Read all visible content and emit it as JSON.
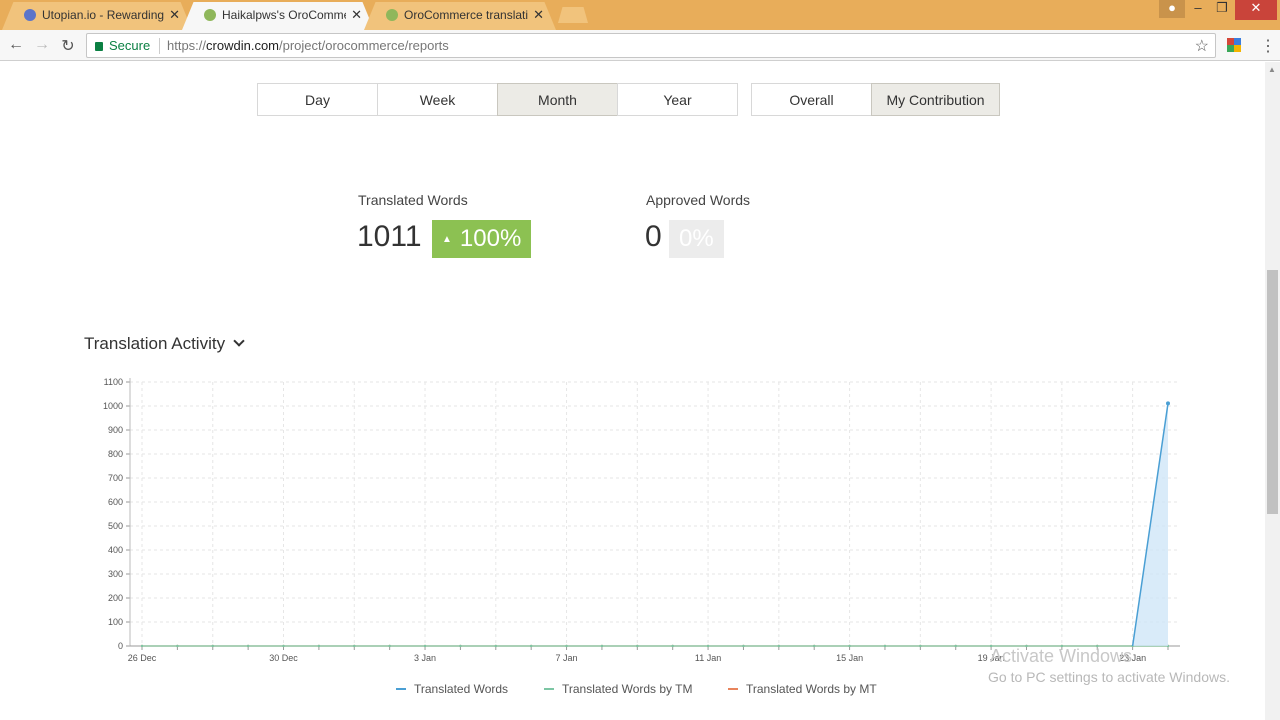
{
  "browser": {
    "tabs": [
      {
        "title": "Utopian.io - Rewarding C",
        "favicon_color": "#5b74c9"
      },
      {
        "title": "Haikalpws's OroCommer",
        "favicon_color": "#8fb75b"
      },
      {
        "title": "OroCommerce translatio",
        "favicon_color": "#8fb75b"
      }
    ],
    "close_glyph": "✕",
    "secure_label": "Secure",
    "url_scheme": "https://",
    "url_host": "crowdin.com",
    "url_path": "/project/orocommerce/reports"
  },
  "periods": [
    "Day",
    "Week",
    "Month",
    "Year"
  ],
  "active_period": "Month",
  "scopes": [
    "Overall",
    "My Contribution"
  ],
  "active_scope": "My Contribution",
  "stats": {
    "translated_label": "Translated Words",
    "translated_value": "1011",
    "translated_change": "100%",
    "approved_label": "Approved Words",
    "approved_value": "0",
    "approved_change": "0%"
  },
  "section": {
    "title": "Translation Activity"
  },
  "chart_data": {
    "type": "line",
    "title": "",
    "xlabel": "",
    "ylabel": "",
    "ylim": [
      0,
      1100
    ],
    "yticks": [
      0,
      100,
      200,
      300,
      400,
      500,
      600,
      700,
      800,
      900,
      1000,
      1100
    ],
    "xtick_labels": [
      "26 Dec",
      "30 Dec",
      "3 Jan",
      "7 Jan",
      "11 Jan",
      "15 Jan",
      "19 Jan",
      "23 Jan"
    ],
    "grid": true,
    "legend_position": "bottom",
    "x": [
      "26 Dec",
      "27 Dec",
      "28 Dec",
      "29 Dec",
      "30 Dec",
      "31 Dec",
      "1 Jan",
      "2 Jan",
      "3 Jan",
      "4 Jan",
      "5 Jan",
      "6 Jan",
      "7 Jan",
      "8 Jan",
      "9 Jan",
      "10 Jan",
      "11 Jan",
      "12 Jan",
      "13 Jan",
      "14 Jan",
      "15 Jan",
      "16 Jan",
      "17 Jan",
      "18 Jan",
      "19 Jan",
      "20 Jan",
      "21 Jan",
      "22 Jan",
      "23 Jan",
      "24 Jan"
    ],
    "series": [
      {
        "name": "Translated Words",
        "color": "#4a9fd4",
        "values": [
          0,
          0,
          0,
          0,
          0,
          0,
          0,
          0,
          0,
          0,
          0,
          0,
          0,
          0,
          0,
          0,
          0,
          0,
          0,
          0,
          0,
          0,
          0,
          0,
          0,
          0,
          0,
          0,
          0,
          1011
        ]
      },
      {
        "name": "Translated Words by TM",
        "color": "#7cc6a4",
        "values": [
          0,
          0,
          0,
          0,
          0,
          0,
          0,
          0,
          0,
          0,
          0,
          0,
          0,
          0,
          0,
          0,
          0,
          0,
          0,
          0,
          0,
          0,
          0,
          0,
          0,
          0,
          0,
          0,
          0,
          0
        ]
      },
      {
        "name": "Translated Words by MT",
        "color": "#e8845c",
        "values": [
          0,
          0,
          0,
          0,
          0,
          0,
          0,
          0,
          0,
          0,
          0,
          0,
          0,
          0,
          0,
          0,
          0,
          0,
          0,
          0,
          0,
          0,
          0,
          0,
          0,
          0,
          0,
          0,
          0,
          0
        ]
      }
    ]
  },
  "watermark": {
    "line1": "Activate Windows",
    "line2": "Go to PC settings to activate Windows."
  }
}
